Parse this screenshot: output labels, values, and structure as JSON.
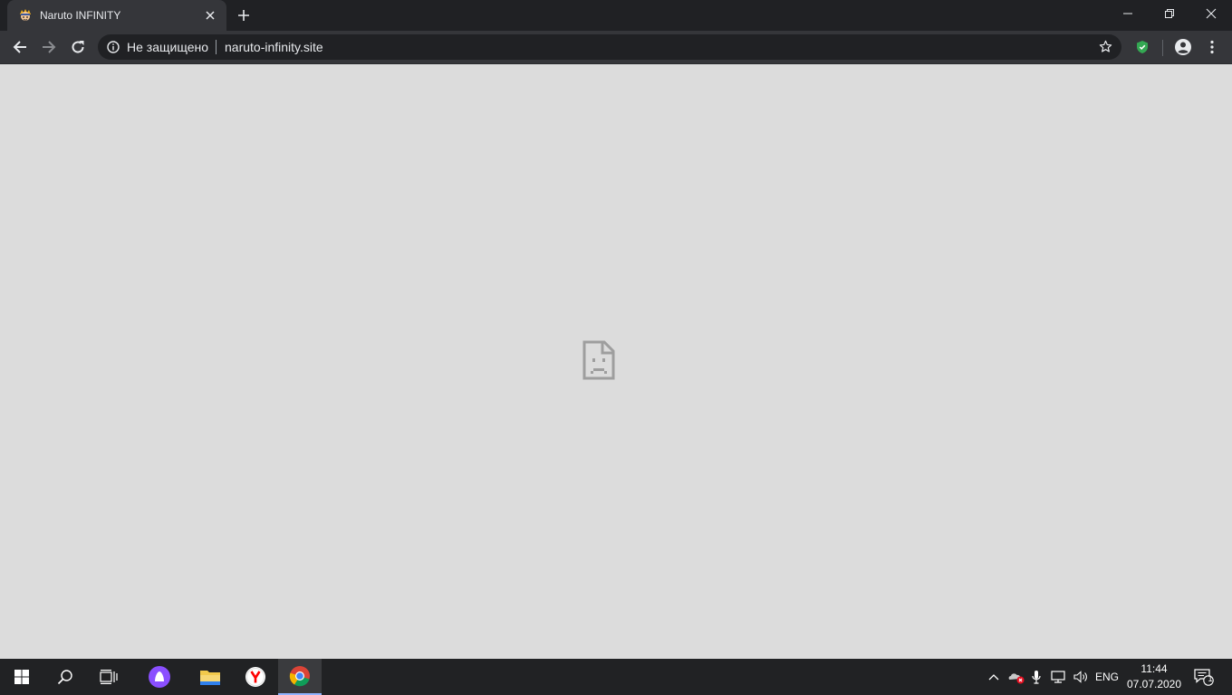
{
  "browser": {
    "tab": {
      "title": "Naruto INFINITY"
    },
    "omnibox": {
      "security_label": "Не защищено",
      "url": "naruto-infinity.site"
    },
    "content": {
      "state": "sad-tab-page-error",
      "icon": "sad-document-icon"
    }
  },
  "taskbar": {
    "apps": [
      "windows-start-icon",
      "search-icon",
      "task-view-icon",
      "alice-icon",
      "file-explorer-icon",
      "yandex-browser-icon",
      "chrome-icon"
    ],
    "active_app": "chrome-icon",
    "language": "ENG",
    "time": "11:44",
    "date": "07.07.2020",
    "notifications_count": "1"
  },
  "colors": {
    "tabstrip": "#202124",
    "toolbar": "#35363a",
    "content_bg": "#dcdcdc",
    "taskbar": "#212224",
    "shield_green": "#34a853"
  }
}
